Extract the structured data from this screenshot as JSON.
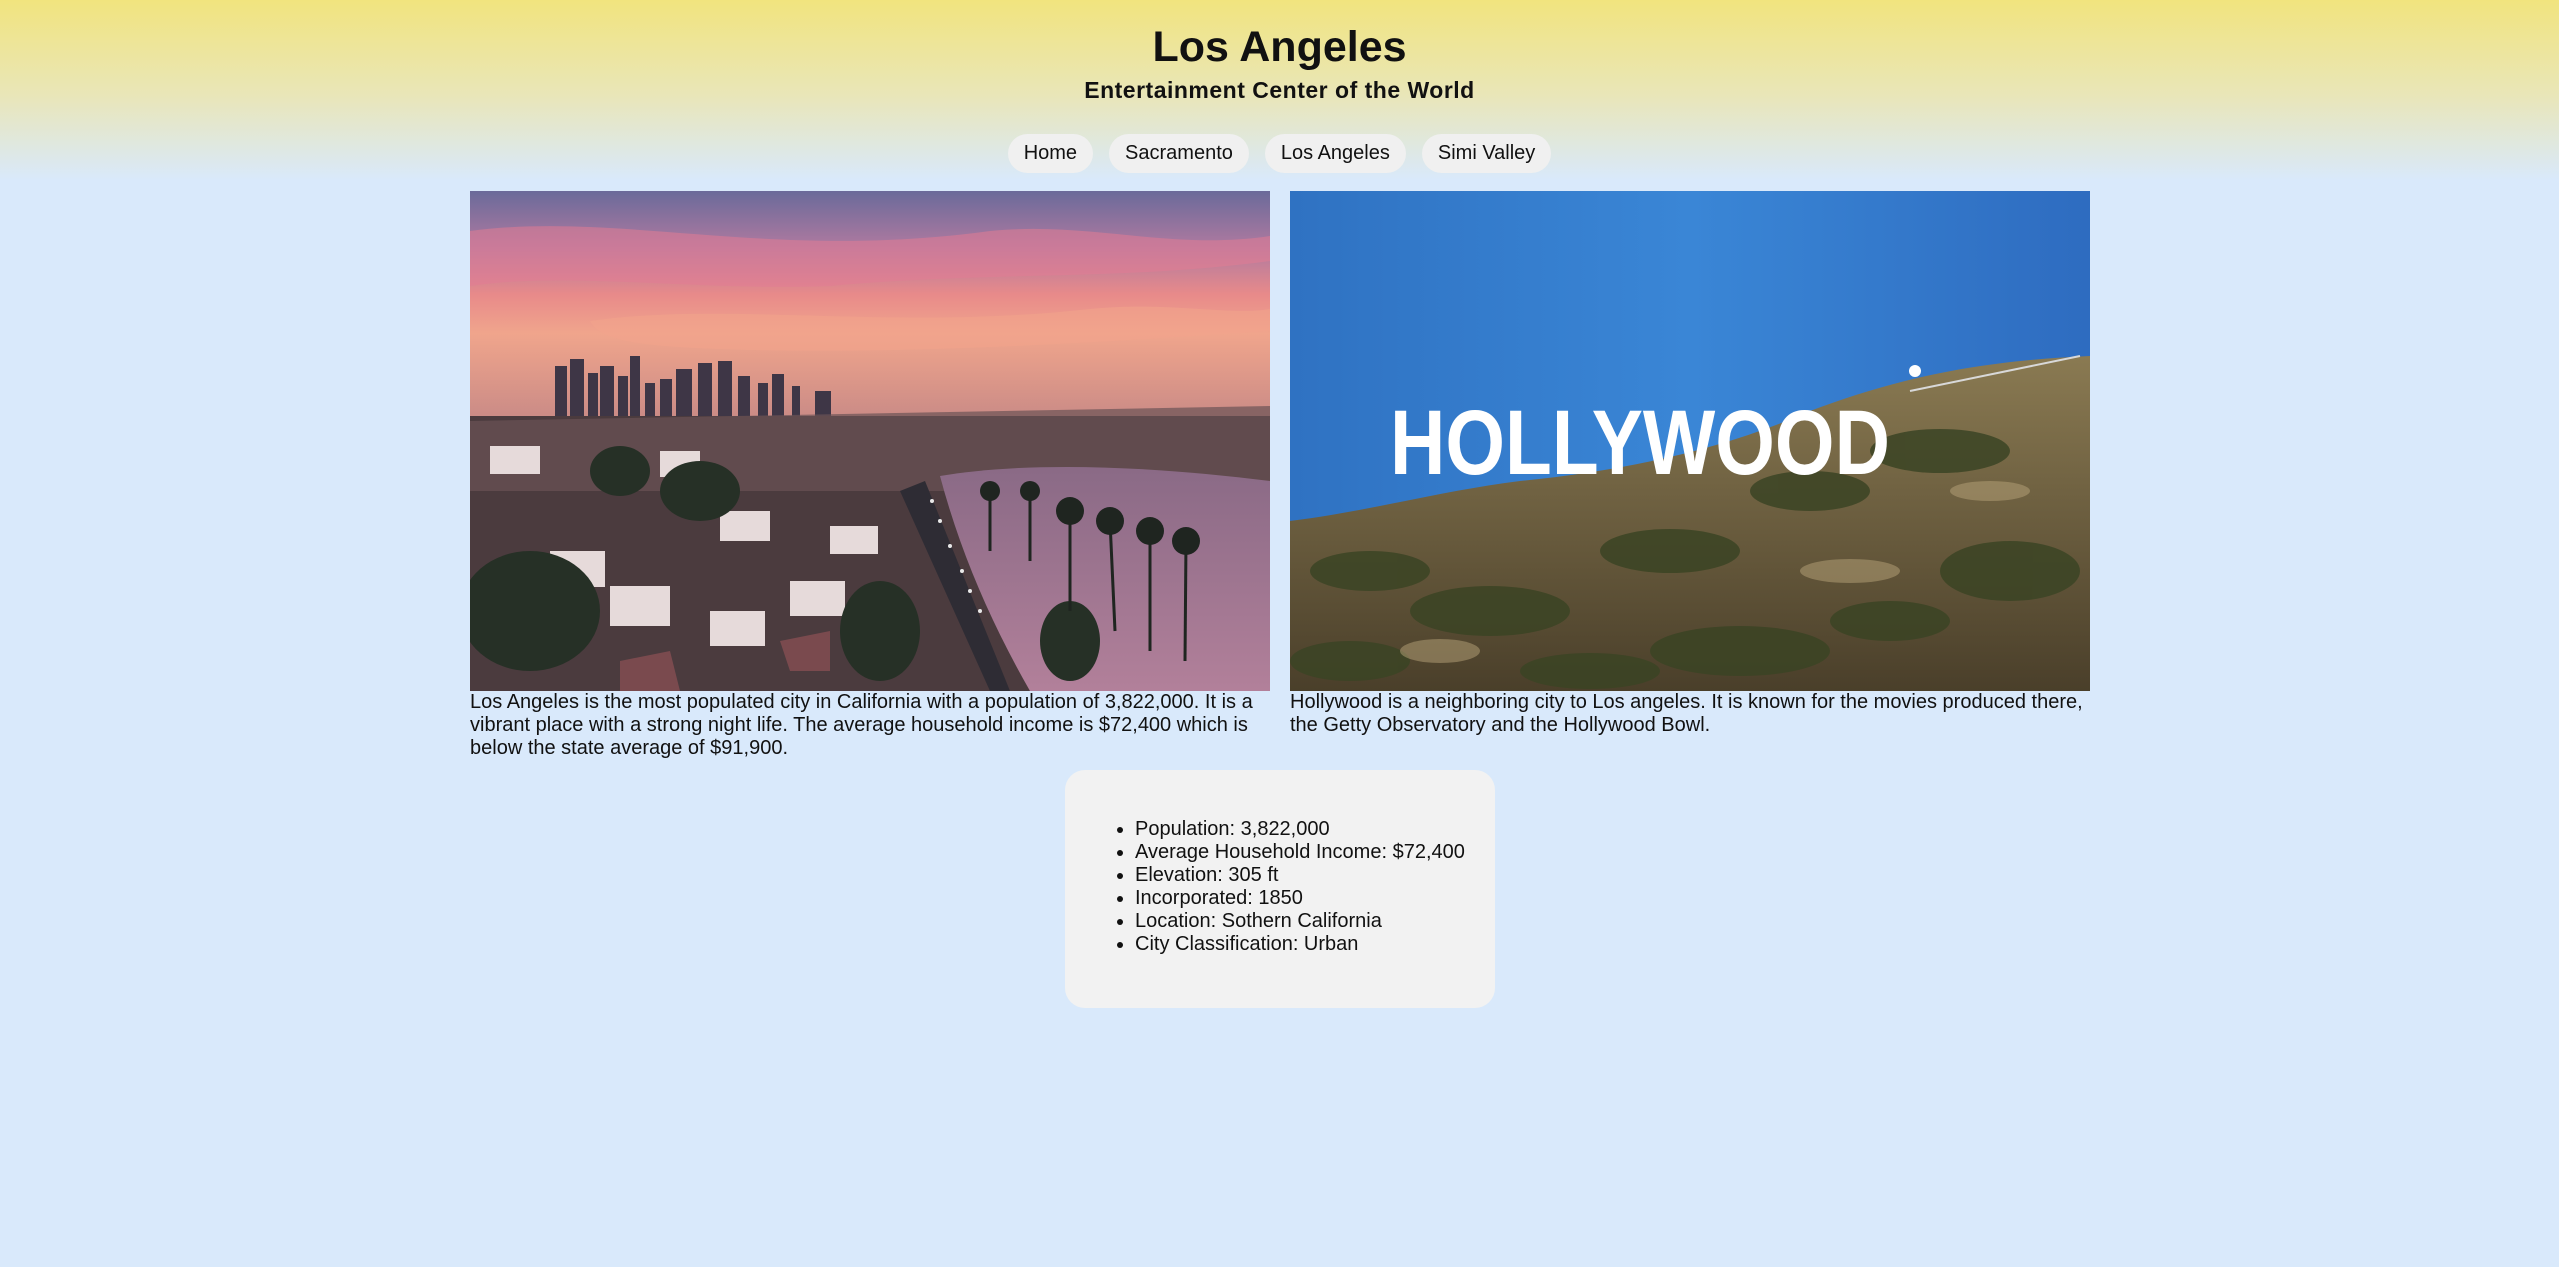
{
  "header": {
    "title": "Los Angeles",
    "subtitle": "Entertainment Center of the World"
  },
  "nav": [
    "Home",
    "Sacramento",
    "Los Angeles",
    "Simi Valley"
  ],
  "gallery": [
    {
      "image": "los-angeles-skyline-sunset-photo",
      "caption": "Los Angeles is the most populated city in California with a population of 3,822,000. It is a vibrant place with a strong night life. The average household income is $72,400 which is below the state average of $91,900."
    },
    {
      "image": "hollywood-sign-photo",
      "sign_text": "HOLLYWOOD",
      "caption": "Hollywood is a neighboring city to Los angeles. It is known for the movies produced there, the Getty Observatory and the Hollywood Bowl."
    }
  ],
  "facts": [
    "Population: 3,822,000",
    "Average Household Income: $72,400",
    "Elevation: 305 ft",
    "Incorporated: 1850",
    "Location: Sothern California",
    "City Classification: Urban"
  ],
  "colors": {
    "header_gradient_top": "#f1e47e",
    "background": "#d9e9fb",
    "nav_pill": "#f0f0f0",
    "info_box": "#f2f2f2"
  }
}
